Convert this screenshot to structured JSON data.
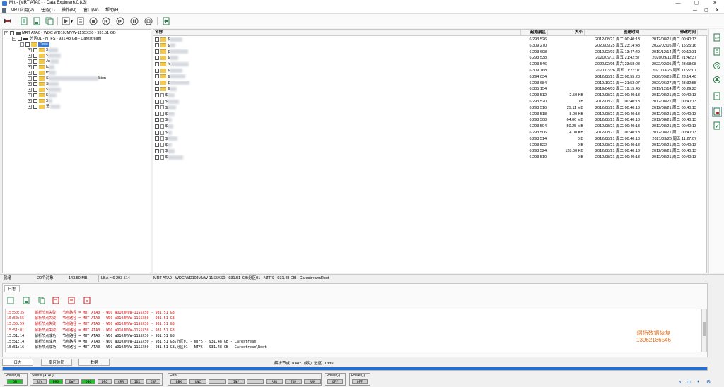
{
  "window": {
    "title": "Mrt - [MRT ATA0 - - Data Explorer6.0.8.3]",
    "controls": [
      "—",
      "▢",
      "✕"
    ]
  },
  "menu": {
    "items": [
      "MRT应用(P)",
      "任务(T)",
      "操作(M)",
      "窗口(W)",
      "帮助(H)"
    ],
    "right_controls": [
      "—",
      "▢",
      "✕"
    ]
  },
  "toolbar": {
    "icons": [
      "disk-icon",
      "doc-icon",
      "doc-icon",
      "doc-icon",
      "play-icon",
      "stop-icon",
      "skip-icon",
      "pause-icon",
      "stop-circle-icon",
      "exit-icon"
    ]
  },
  "tree": {
    "disk": "MRT ATA0 - WDC WD10JMVW-11S5XS0 - 931.51 GB",
    "partition": "分区01 - NTFS - 931.48 GB - Carestream",
    "root": "Root",
    "children": [
      "$",
      "$",
      "Ju",
      "fc",
      "fc",
      "S",
      "S",
      "$",
      "$",
      "$",
      "透"
    ],
    "child_tail": "lition"
  },
  "list": {
    "columns": [
      "名称",
      "起始扇区",
      "大小",
      "创建时间",
      "修改时间"
    ],
    "rows": [
      {
        "type": "folder",
        "sector": "6 293 526",
        "size": "",
        "created": "2012/08/21 周二 00:40:13",
        "modified": "2012/08/21 周二 00:40:13"
      },
      {
        "type": "folder",
        "sector": "6 309 270",
        "size": "",
        "created": "2020/09/25 周五 23:14:43",
        "modified": "2022/02/05 周六 15:25:16"
      },
      {
        "type": "folder",
        "sector": "6 293 608",
        "size": "",
        "created": "2012/02/03 周五 13:47:49",
        "modified": "2019/12/14 周六 00:10:31"
      },
      {
        "type": "folder",
        "sector": "6 293 538",
        "size": "",
        "created": "2020/09/11 周五 21:42:37",
        "modified": "2020/09/11 周五 21:42:37"
      },
      {
        "type": "folder",
        "sector": "6 293 546",
        "size": "",
        "created": "2022/02/05 周六 23:58:08",
        "modified": "2022/02/05 周六 23:58:08"
      },
      {
        "type": "folder",
        "sector": "6 309 768",
        "size": "",
        "created": "2021/03/26 周五 11:27:07",
        "modified": "2021/03/26 周五 11:27:07"
      },
      {
        "type": "folder",
        "sector": "6 294 034",
        "size": "",
        "created": "2012/08/21 周二 00:55:28",
        "modified": "2020/09/25 周五 23:14:40"
      },
      {
        "type": "folder",
        "sector": "6 293 684",
        "size": "",
        "created": "2019/10/21 周一 21:53:07",
        "modified": "2020/06/27 周六 23:32:55"
      },
      {
        "type": "folder",
        "sector": "6 305 154",
        "size": "",
        "created": "2019/04/03 周三 19:15:45",
        "modified": "2019/12/14 周六 00:29:23"
      },
      {
        "type": "file",
        "sector": "6 293 512",
        "size": "2.50 KB",
        "created": "2012/08/21 周二 00:40:13",
        "modified": "2012/08/21 周二 00:40:13"
      },
      {
        "type": "file",
        "sector": "6 293 520",
        "size": "0 B",
        "created": "2012/08/21 周二 00:40:13",
        "modified": "2012/08/21 周二 00:40:13"
      },
      {
        "type": "file",
        "sector": "6 293 516",
        "size": "29.11 MB",
        "created": "2012/08/21 周二 00:40:13",
        "modified": "2012/08/21 周二 00:40:13"
      },
      {
        "type": "file",
        "sector": "6 293 518",
        "size": "8.00 KB",
        "created": "2012/08/21 周二 00:40:13",
        "modified": "2012/08/21 周二 00:40:13"
      },
      {
        "type": "file",
        "sector": "6 293 508",
        "size": "64.00 MB",
        "created": "2012/08/21 周二 00:40:13",
        "modified": "2012/08/21 周二 00:40:13"
      },
      {
        "type": "file",
        "sector": "6 293 504",
        "size": "50.25 MB",
        "created": "2012/08/21 周二 00:40:13",
        "modified": "2012/08/21 周二 00:40:13"
      },
      {
        "type": "file",
        "sector": "6 293 506",
        "size": "4.00 KB",
        "created": "2012/08/21 周二 00:40:13",
        "modified": "2012/08/21 周二 00:40:13"
      },
      {
        "type": "file",
        "sector": "6 293 514",
        "size": "0 B",
        "created": "2012/08/21 周二 00:40:13",
        "modified": "2021/03/26 周五 11:27:07"
      },
      {
        "type": "file",
        "sector": "6 293 522",
        "size": "0 B",
        "created": "2012/08/21 周二 00:40:13",
        "modified": "2012/08/21 周二 00:40:13"
      },
      {
        "type": "file",
        "sector": "6 293 524",
        "size": "128.00 KB",
        "created": "2012/08/21 周二 00:40:13",
        "modified": "2012/08/21 周二 00:40:13"
      },
      {
        "type": "file",
        "sector": "6 293 510",
        "size": "0 B",
        "created": "2012/08/21 周二 00:40:13",
        "modified": "2012/08/21 周二 00:40:13"
      }
    ],
    "name_prefixes": [
      "$",
      "$",
      "$",
      "$",
      "fc",
      "$",
      "$",
      "$",
      "$",
      "$",
      "$",
      "$",
      "$",
      "$",
      "$",
      "$",
      "$",
      "$",
      "$",
      "$"
    ]
  },
  "status": {
    "ready": "就绪",
    "count": "20个对象",
    "size": "143.50 MB",
    "lba": "LBA = 6 293 514",
    "path": "MRT ATA0 - WDC WD10JMVW-11S5XS0 - 931.51 GB\\分区01 - NTFS - 931.48 GB - Carestream\\Root"
  },
  "log": {
    "tab": "日志",
    "lines": [
      {
        "time": "15:50:35",
        "msg": "解析节点失败!  节点路径 = MRT ATA0 - WDC WD10JMVW-11S5XS0 - 931.51 GB",
        "color": "#d01010"
      },
      {
        "time": "15:50:55",
        "msg": "解析节点失败!  节点路径 = MRT ATA0 - WDC WD10JMVW-11S5XS0 - 931.51 GB",
        "color": "#d01010"
      },
      {
        "time": "15:50:59",
        "msg": "解析节点失败!  节点路径 = MRT ATA0 - WDC WD10JMVW-11S5XS0 - 931.51 GB",
        "color": "#d01010"
      },
      {
        "time": "15:51:01",
        "msg": "解析节点失败!  节点路径 = MRT ATA0 - WDC WD10JMVW-11S5XS0 - 931.51 GB",
        "color": "#d01010"
      },
      {
        "time": "15:51:14",
        "msg": "解析节点成功!  节点路径 = MRT ATA0 - WDC WD10JMVW-11S5XS0 - 931.51 GB",
        "color": "#000000"
      },
      {
        "time": "15:51:14",
        "msg": "解析节点成功!  节点路径 = MRT ATA0 - WDC WD10JMVW-11S5XS0 - 931.51 GB\\分区01 - NTFS - 931.48 GB - Carestream",
        "color": "#000000"
      },
      {
        "time": "15:51:16",
        "msg": "解析节点成功!  节点路径 = MRT ATA0 - WDC WD10JMVW-11S5XS0 - 931.51 GB\\分区01 - NTFS - 931.48 GB - Carestream\\Root",
        "color": "#000000"
      }
    ],
    "watermark_line1": "熠扬数据恢复",
    "watermark_line2": "13962186546"
  },
  "bottom": {
    "tabs": [
      "日志",
      "扇区位图",
      "数据"
    ],
    "progress_text": "解析节点 Root 成功  进度 100%",
    "progress": 1.0
  },
  "indicators": {
    "power0_label": "Power(0)",
    "power0_led": "ON",
    "status_label": "Status (ATA0)",
    "status_leds": [
      "BSY",
      "DRD",
      "DWF",
      "DSC",
      "DRQ",
      "CRR",
      "IDX",
      "ERR"
    ],
    "status_on": [
      false,
      true,
      false,
      true,
      false,
      false,
      false,
      false
    ],
    "error_label": "Error",
    "error_leds": [
      "BBK",
      "UNC",
      "",
      "INF",
      "",
      "ABR",
      "TON",
      "AMN"
    ],
    "power1_label": "Power(-)",
    "power1_led": "OFF",
    "power2_label": "Power(-)",
    "power2_led": "OFF",
    "led_on_color": "#22c22a"
  },
  "tray": [
    "∧",
    "中",
    "◐",
    "⚙"
  ]
}
